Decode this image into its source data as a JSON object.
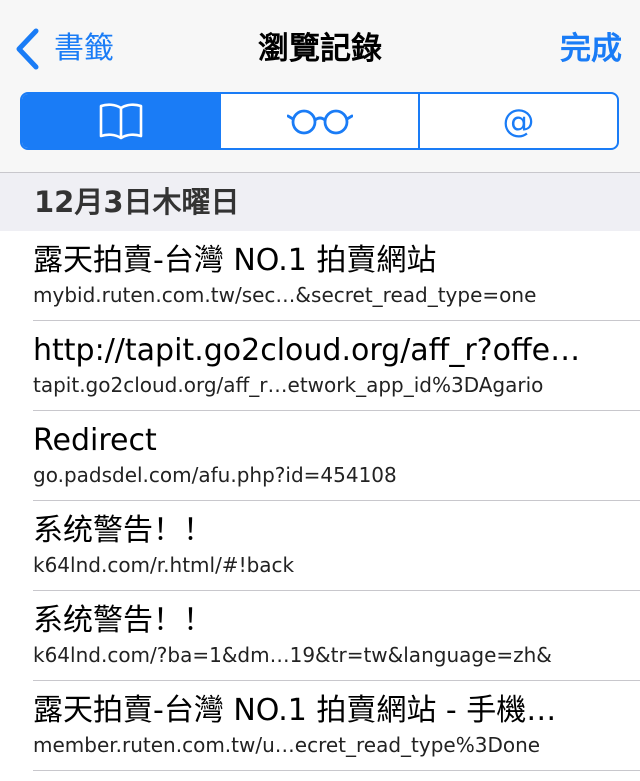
{
  "nav": {
    "back_label": "書籤",
    "title": "瀏覽記錄",
    "done_label": "完成"
  },
  "segments": [
    {
      "icon": "book-icon",
      "active": true
    },
    {
      "icon": "reading-glasses-icon",
      "active": false
    },
    {
      "icon": "at-sign-icon",
      "label": "@",
      "active": false
    }
  ],
  "section": {
    "date": "12月3日木曜日"
  },
  "history": [
    {
      "title": "露天拍賣-台灣 NO.1 拍賣網站",
      "url": "mybid.ruten.com.tw/sec…&secret_read_type=one"
    },
    {
      "title": "http://tapit.go2cloud.org/aff_r?offe…",
      "url": "tapit.go2cloud.org/aff_r…etwork_app_id%3DAgario"
    },
    {
      "title": "Redirect",
      "url": "go.padsdel.com/afu.php?id=454108"
    },
    {
      "title": "系统警告！！",
      "url": "k64lnd.com/r.html/#!back"
    },
    {
      "title": "系统警告！！",
      "url": "k64lnd.com/?ba=1&dm…19&tr=tw&language=zh&"
    },
    {
      "title": "露天拍賣-台灣 NO.1 拍賣網站 - 手機…",
      "url": "member.ruten.com.tw/u…ecret_read_type%3Done"
    }
  ],
  "colors": {
    "accent": "#1a7cf6",
    "navbar_bg": "#f7f7f7",
    "section_bg": "#efeff4",
    "separator": "#c8c7cc"
  }
}
